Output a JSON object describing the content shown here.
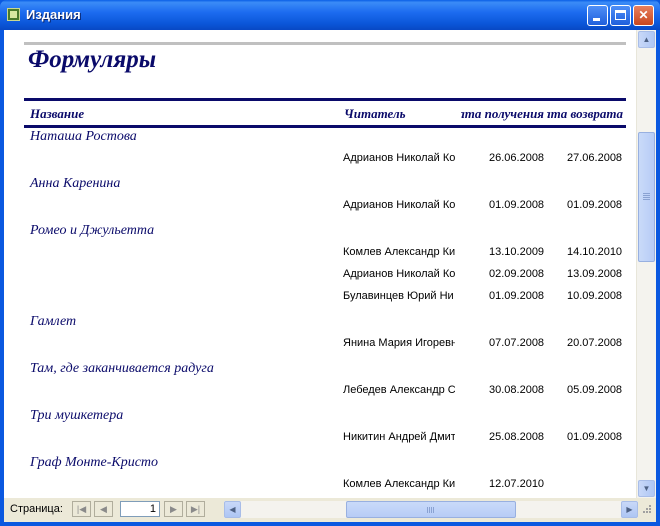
{
  "window": {
    "title": "Издания",
    "app_icon": "form-icon"
  },
  "report": {
    "title": "Формуляры",
    "columns": {
      "name": "Название",
      "reader": "Читатель",
      "date_get": "Дата получения",
      "date_return": "Дата возврата"
    },
    "books": [
      {
        "title": "Наташа Ростова",
        "loans": [
          {
            "reader": "Адрианов Николай Ко",
            "date_get": "26.06.2008",
            "date_return": "27.06.2008"
          }
        ]
      },
      {
        "title": "Анна Каренина",
        "loans": [
          {
            "reader": "Адрианов Николай Ко",
            "date_get": "01.09.2008",
            "date_return": "01.09.2008"
          }
        ]
      },
      {
        "title": "Ромео и Джульетта",
        "loans": [
          {
            "reader": "Комлев Александр Ки",
            "date_get": "13.10.2009",
            "date_return": "14.10.2010"
          },
          {
            "reader": "Адрианов Николай Ко",
            "date_get": "02.09.2008",
            "date_return": "13.09.2008"
          },
          {
            "reader": "Булавинцев Юрий Ни",
            "date_get": "01.09.2008",
            "date_return": "10.09.2008"
          }
        ]
      },
      {
        "title": "Гамлет",
        "loans": [
          {
            "reader": "Янина Мария Игоревн",
            "date_get": "07.07.2008",
            "date_return": "20.07.2008"
          }
        ]
      },
      {
        "title": "Там, где заканчивается радуга",
        "loans": [
          {
            "reader": "Лебедев Александр С",
            "date_get": "30.08.2008",
            "date_return": "05.09.2008"
          }
        ]
      },
      {
        "title": "Три мушкетера",
        "loans": [
          {
            "reader": "Никитин Андрей Дмит",
            "date_get": "25.08.2008",
            "date_return": "01.09.2008"
          }
        ]
      },
      {
        "title": "Граф Монте-Кристо",
        "loans": [
          {
            "reader": "Комлев Александр Ки",
            "date_get": "12.07.2010",
            "date_return": ""
          }
        ]
      }
    ]
  },
  "navigation": {
    "page_label": "Страница:",
    "page_number": "1"
  }
}
